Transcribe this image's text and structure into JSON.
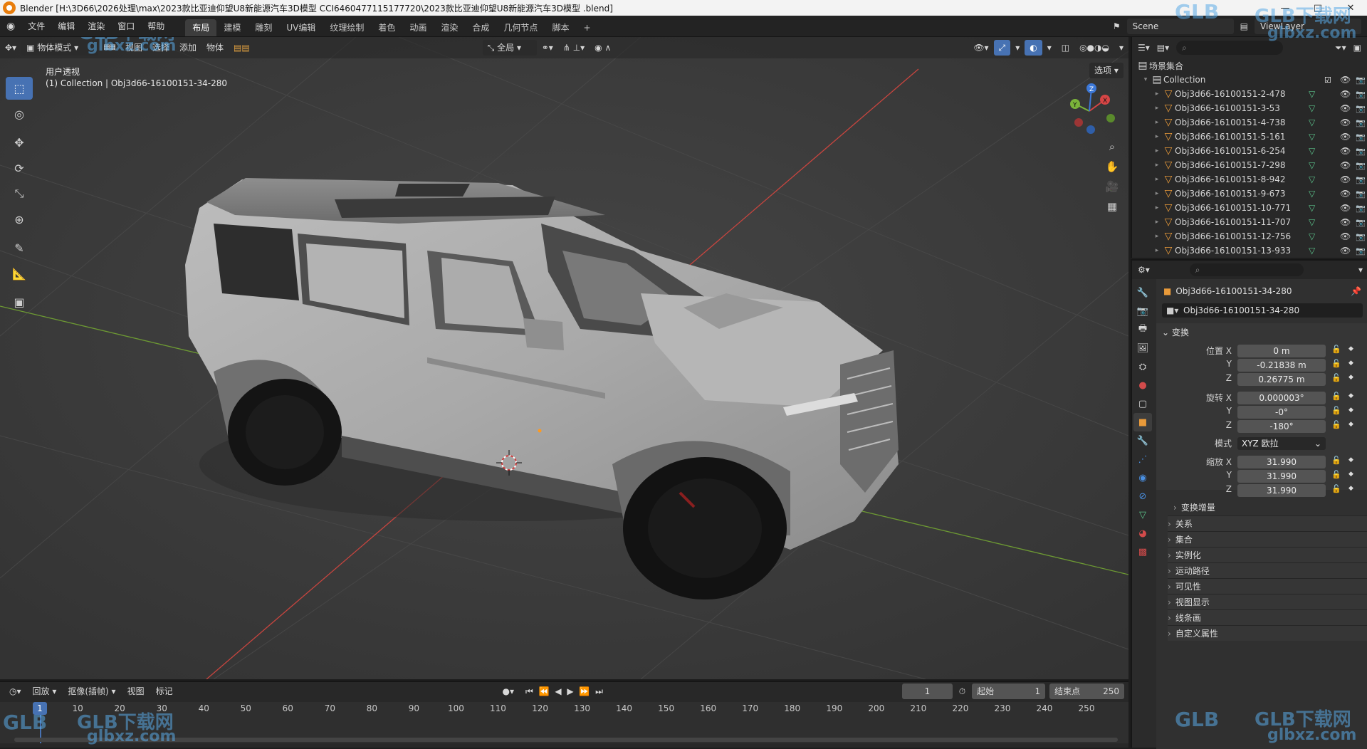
{
  "window": {
    "title": "Blender [H:\\3D66\\2026处理\\max\\2023款比亚迪仰望U8新能源汽车3D模型 CCI6460477115177720\\2023款比亚迪仰望U8新能源汽车3D模型 .blend]",
    "controls": [
      "—",
      "□",
      "✕"
    ]
  },
  "menu": {
    "items": [
      "文件",
      "编辑",
      "渲染",
      "窗口",
      "帮助"
    ],
    "workspaces": [
      "布局",
      "建模",
      "雕刻",
      "UV编辑",
      "纹理绘制",
      "着色",
      "动画",
      "渲染",
      "合成",
      "几何节点",
      "脚本",
      "+"
    ],
    "active_workspace": "布局",
    "scene": "Scene",
    "view_layer": "ViewLayer"
  },
  "viewport": {
    "mode": "物体模式",
    "menus": [
      "视图",
      "选择",
      "添加",
      "物体"
    ],
    "orientation": "全局",
    "options": "选项",
    "overlay_title": "用户透视",
    "overlay_sub": "(1) Collection | Obj3d66-16100151-34-280",
    "gizmo": {
      "x": "X",
      "y": "Y",
      "z": "Z"
    }
  },
  "outliner": {
    "root": "场景集合",
    "collection": "Collection",
    "objects": [
      "Obj3d66-16100151-2-478",
      "Obj3d66-16100151-3-53",
      "Obj3d66-16100151-4-738",
      "Obj3d66-16100151-5-161",
      "Obj3d66-16100151-6-254",
      "Obj3d66-16100151-7-298",
      "Obj3d66-16100151-8-942",
      "Obj3d66-16100151-9-673",
      "Obj3d66-16100151-10-771",
      "Obj3d66-16100151-11-707",
      "Obj3d66-16100151-12-756",
      "Obj3d66-16100151-13-933"
    ]
  },
  "properties": {
    "object_name": "Obj3d66-16100151-34-280",
    "object_field": "Obj3d66-16100151-34-280",
    "transform_title": "变换",
    "location_label": "位置 X",
    "rotation_label": "旋转 X",
    "scale_label": "缩放 X",
    "axis_y": "Y",
    "axis_z": "Z",
    "location": {
      "x": "0 m",
      "y": "-0.21838 m",
      "z": "0.26775 m"
    },
    "rotation": {
      "x": "0.000003°",
      "y": "-0°",
      "z": "-180°"
    },
    "mode_label": "模式",
    "mode_value": "XYZ 欧拉",
    "scale": {
      "x": "31.990",
      "y": "31.990",
      "z": "31.990"
    },
    "delta_transform": "变换增量",
    "panels": [
      "关系",
      "集合",
      "实例化",
      "运动路径",
      "可见性",
      "视图显示",
      "线条画",
      "自定义属性"
    ]
  },
  "timeline": {
    "menus": [
      "回放",
      "抠像(插帧)",
      "视图",
      "标记"
    ],
    "current_frame": "1",
    "start_label": "起始",
    "start": "1",
    "end_label": "结束点",
    "end": "250",
    "ticks": [
      "1",
      "10",
      "20",
      "30",
      "40",
      "50",
      "60",
      "70",
      "80",
      "90",
      "100",
      "110",
      "120",
      "130",
      "140",
      "150",
      "160",
      "170",
      "180",
      "190",
      "200",
      "210",
      "220",
      "230",
      "240",
      "250"
    ]
  },
  "watermark": {
    "brand": "GLB下载网",
    "url": "glbxz.com",
    "logo": "GLB"
  },
  "colors": {
    "accent": "#4772b3",
    "mesh": "#e89a3a",
    "axis_x": "#d64545",
    "axis_y": "#7ab33a",
    "axis_z": "#3c78d8"
  }
}
